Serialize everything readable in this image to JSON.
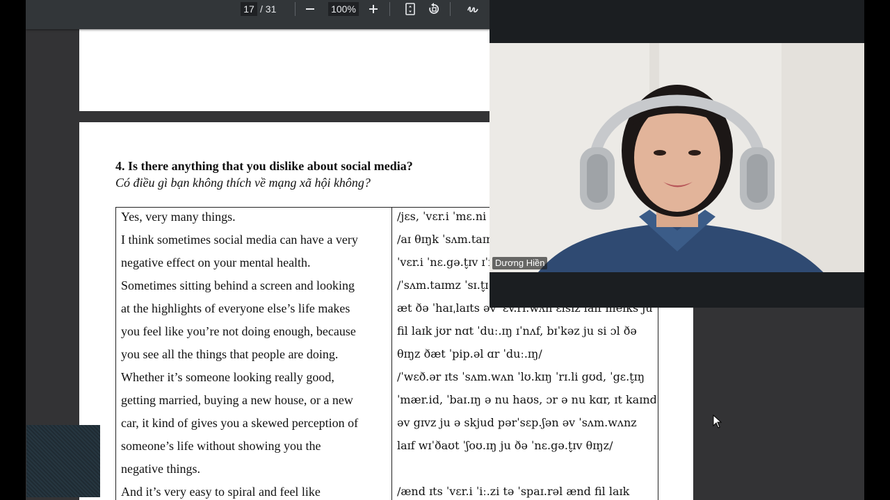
{
  "toolbar": {
    "current_page": "17",
    "page_total": "/ 31",
    "zoom": "100%",
    "icons": [
      "zoom-out-icon",
      "zoom-in-icon",
      "fit-page-icon",
      "rotate-icon",
      "annotate-icon"
    ]
  },
  "question": {
    "title": "4. Is there anything that you dislike about social media?",
    "subtitle": "Có điều gì bạn không thích về mạng xã hội không?"
  },
  "table": {
    "english_lines": [
      "Yes, very many things.",
      "I think sometimes social media can have a very",
      "negative effect on  your mental health.",
      "Sometimes sitting behind a screen and looking",
      "at the highlights of everyone else’s life makes",
      "you feel like you’re not doing enough, because",
      "you see all the things that people are doing.",
      "Whether it’s someone looking really good,",
      "getting married, buying a new house, or a new",
      "car, it kind of gives you a skewed perception of",
      "someone’s life without showing you the",
      "negative things.",
      "And it’s very easy to spiral and feel like"
    ],
    "ipa_lines": [
      "/jɛs, ˈvɛr.i ˈmɛ.ni",
      "/aɪ θɪŋk ˈsʌm.taɪm",
      "ˈvɛr.i ˈnɛ.gə.t̬ɪv ɪˈf",
      "/ˈsʌm.taɪmz ˈsɪ.t̬ɪ",
      "æt ðə ˈhaɪˌlaɪts əv ˈɛv.ri.wʌn ɛlsɪz laɪf meɪks ju",
      "fil laɪk jʊr nɑt ˈduː.ɪŋ ɪˈnʌf, bɪˈkəz ju si ɔl ðə",
      "θɪŋz ðæt ˈpip.əl ɑr ˈduː.ɪŋ/",
      "/ˈwɛð.ər ɪts ˈsʌm.wʌn ˈlʊ.kɪŋ ˈrɪ.li gʊd, ˈgɛ.t̬ɪŋ",
      "ˈmær.id, ˈbaɪ.ɪŋ ə nu haʊs, ɔr ə nu kɑr, ɪt kaɪnd",
      "əv gɪvz ju ə skjud pərˈsɛp.ʃən əv ˈsʌm.wʌnz",
      "laɪf wɪˈðaʊt ˈʃoʊ.ɪŋ ju ðə ˈnɛ.gə.t̬ɪv θɪŋz/",
      "",
      "/ænd ɪts ˈvɛr.i ˈiː.zi tə ˈspaɪ.rəl ænd fil laɪk"
    ]
  },
  "video": {
    "participant_name": "Dương Hiền"
  }
}
